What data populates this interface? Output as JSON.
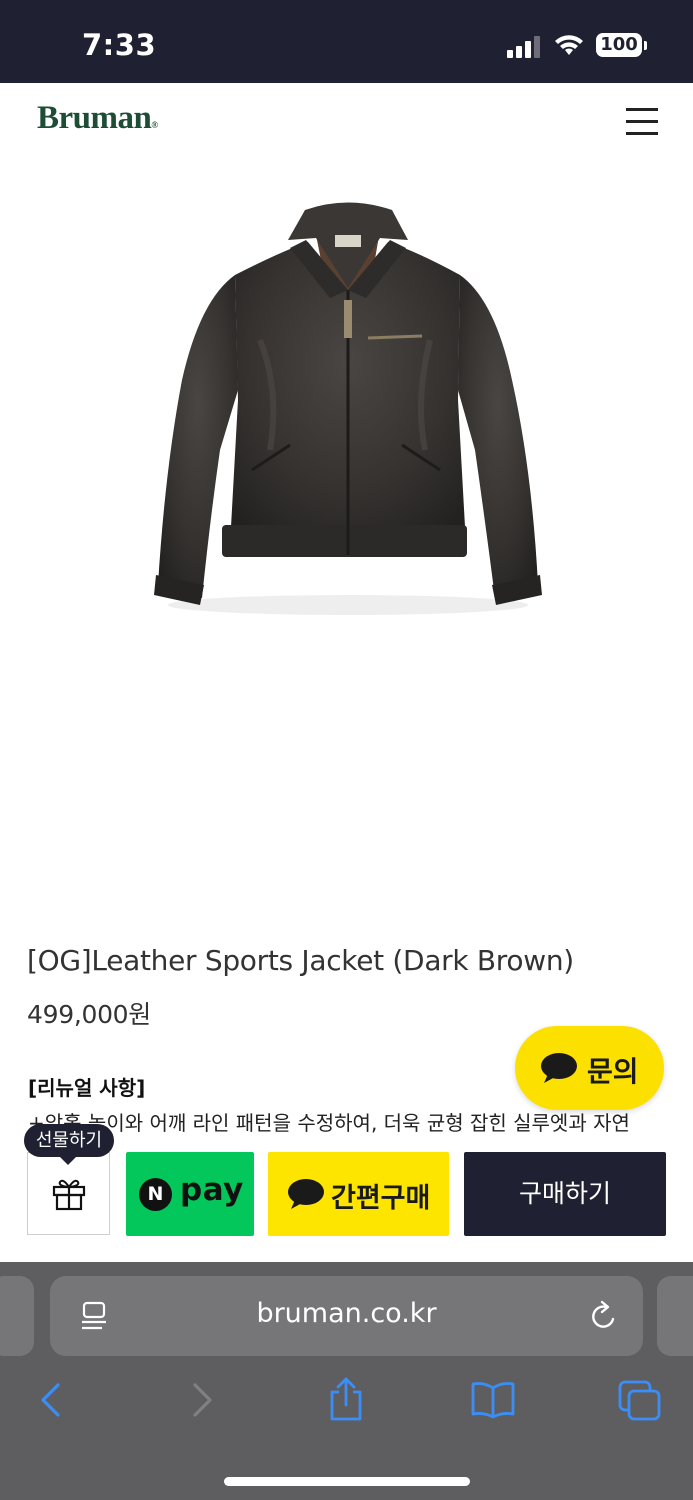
{
  "status_bar": {
    "time": "7:33",
    "battery": "100"
  },
  "header": {
    "logo": "Bruman",
    "logo_mark": "®",
    "brand_color": "#1d4d35"
  },
  "product": {
    "image_icon": "leather-jacket-image",
    "title": "[OG]Leather Sports Jacket (Dark Brown)",
    "price": "499,000원",
    "renewal_heading": "[리뉴얼 사항]",
    "renewal_text": "+암홀 높이와 어깨 라인 패턴을 수정하여, 더욱 균형 잡힌 실루엣과 자연"
  },
  "floating": {
    "inquiry_label": "문의",
    "inquiry_color": "#fce000"
  },
  "buy_bar": {
    "gift_tooltip": "선물하기",
    "npay_n": "N",
    "npay_label": "pay",
    "npay_color": "#03c75a",
    "kakao_label": "간편구매",
    "kakao_color": "#fee500",
    "buy_label": "구매하기",
    "buy_color": "#1f2032"
  },
  "browser": {
    "url": "bruman.co.kr",
    "icons": [
      "reader-icon",
      "reload-icon",
      "back-icon",
      "forward-icon",
      "share-icon",
      "bookmarks-icon",
      "tabs-icon"
    ]
  }
}
